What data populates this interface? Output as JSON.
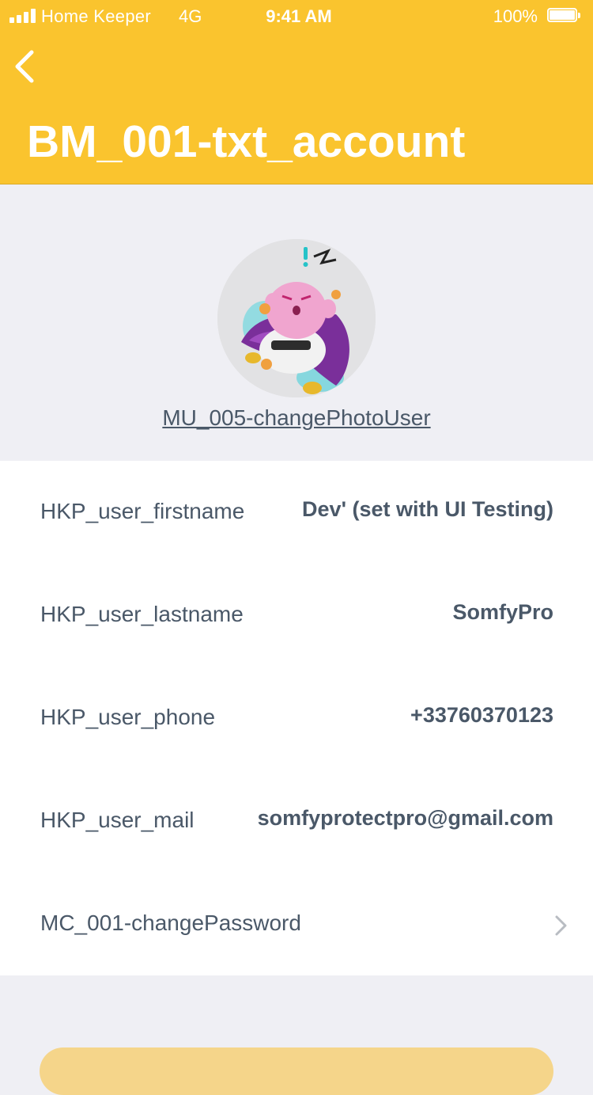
{
  "status_bar": {
    "carrier": "Home Keeper",
    "network": "4G",
    "time": "9:41 AM",
    "battery": "100%"
  },
  "header": {
    "title": "BM_001-txt_account",
    "back_icon": "chevron-left-icon"
  },
  "profile": {
    "change_photo_label": "MU_005-changePhotoUser"
  },
  "user_info": {
    "firstname_label": "HKP_user_firstname",
    "firstname_value": "Dev' (set with UI Testing)",
    "lastname_label": "HKP_user_lastname",
    "lastname_value": "SomfyPro",
    "phone_label": "HKP_user_phone",
    "phone_value": "+33760370123",
    "mail_label": "HKP_user_mail",
    "mail_value": "somfyprotectpro@gmail.com",
    "password_label": "MC_001-changePassword",
    "password_icon": "chevron-right-icon"
  },
  "colors": {
    "brand": "#fac42e",
    "text": "#4a5868",
    "background": "#efeff4",
    "panel": "#ffffff"
  }
}
